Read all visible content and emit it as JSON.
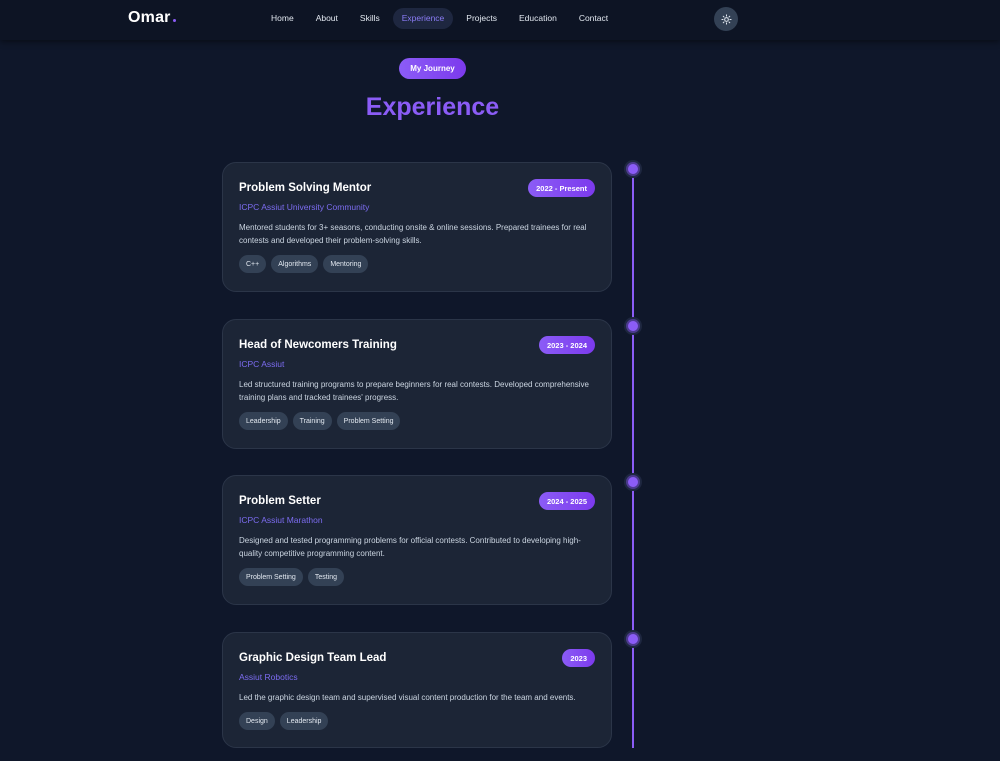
{
  "navbar": {
    "logo": "Omar",
    "links": [
      "Home",
      "About",
      "Skills",
      "Experience",
      "Projects",
      "Education",
      "Contact"
    ],
    "active_link": "Experience",
    "theme_toggle_icon": "sun-icon"
  },
  "header": {
    "pill": "My Journey",
    "title": "Experience"
  },
  "experiences": [
    {
      "title": "Problem Solving Mentor",
      "date": "2022 - Present",
      "org": "ICPC Assiut University Community",
      "description": "Mentored students for 3+ seasons, conducting onsite & online sessions. Prepared trainees for real contests and developed their problem-solving skills.",
      "tags": [
        "C++",
        "Algorithms",
        "Mentoring"
      ]
    },
    {
      "title": "Head of Newcomers Training",
      "date": "2023 - 2024",
      "org": "ICPC Assiut",
      "description": "Led structured training programs to prepare beginners for real contests. Developed comprehensive training plans and tracked trainees' progress.",
      "tags": [
        "Leadership",
        "Training",
        "Problem Setting"
      ]
    },
    {
      "title": "Problem Setter",
      "date": "2024 - 2025",
      "org": "ICPC Assiut Marathon",
      "description": "Designed and tested programming problems for official contests. Contributed to developing high-quality competitive programming content.",
      "tags": [
        "Problem Setting",
        "Testing"
      ]
    },
    {
      "title": "Graphic Design Team Lead",
      "date": "2023",
      "org": "Assiut Robotics",
      "description": "Led the graphic design team and supervised visual content production for the team and events.",
      "tags": [
        "Design",
        "Leadership"
      ]
    }
  ],
  "colors": {
    "background": "#0f172a",
    "accent": "#8b5cf6",
    "card": "#1c2536",
    "org_text": "#7c6cf0"
  }
}
